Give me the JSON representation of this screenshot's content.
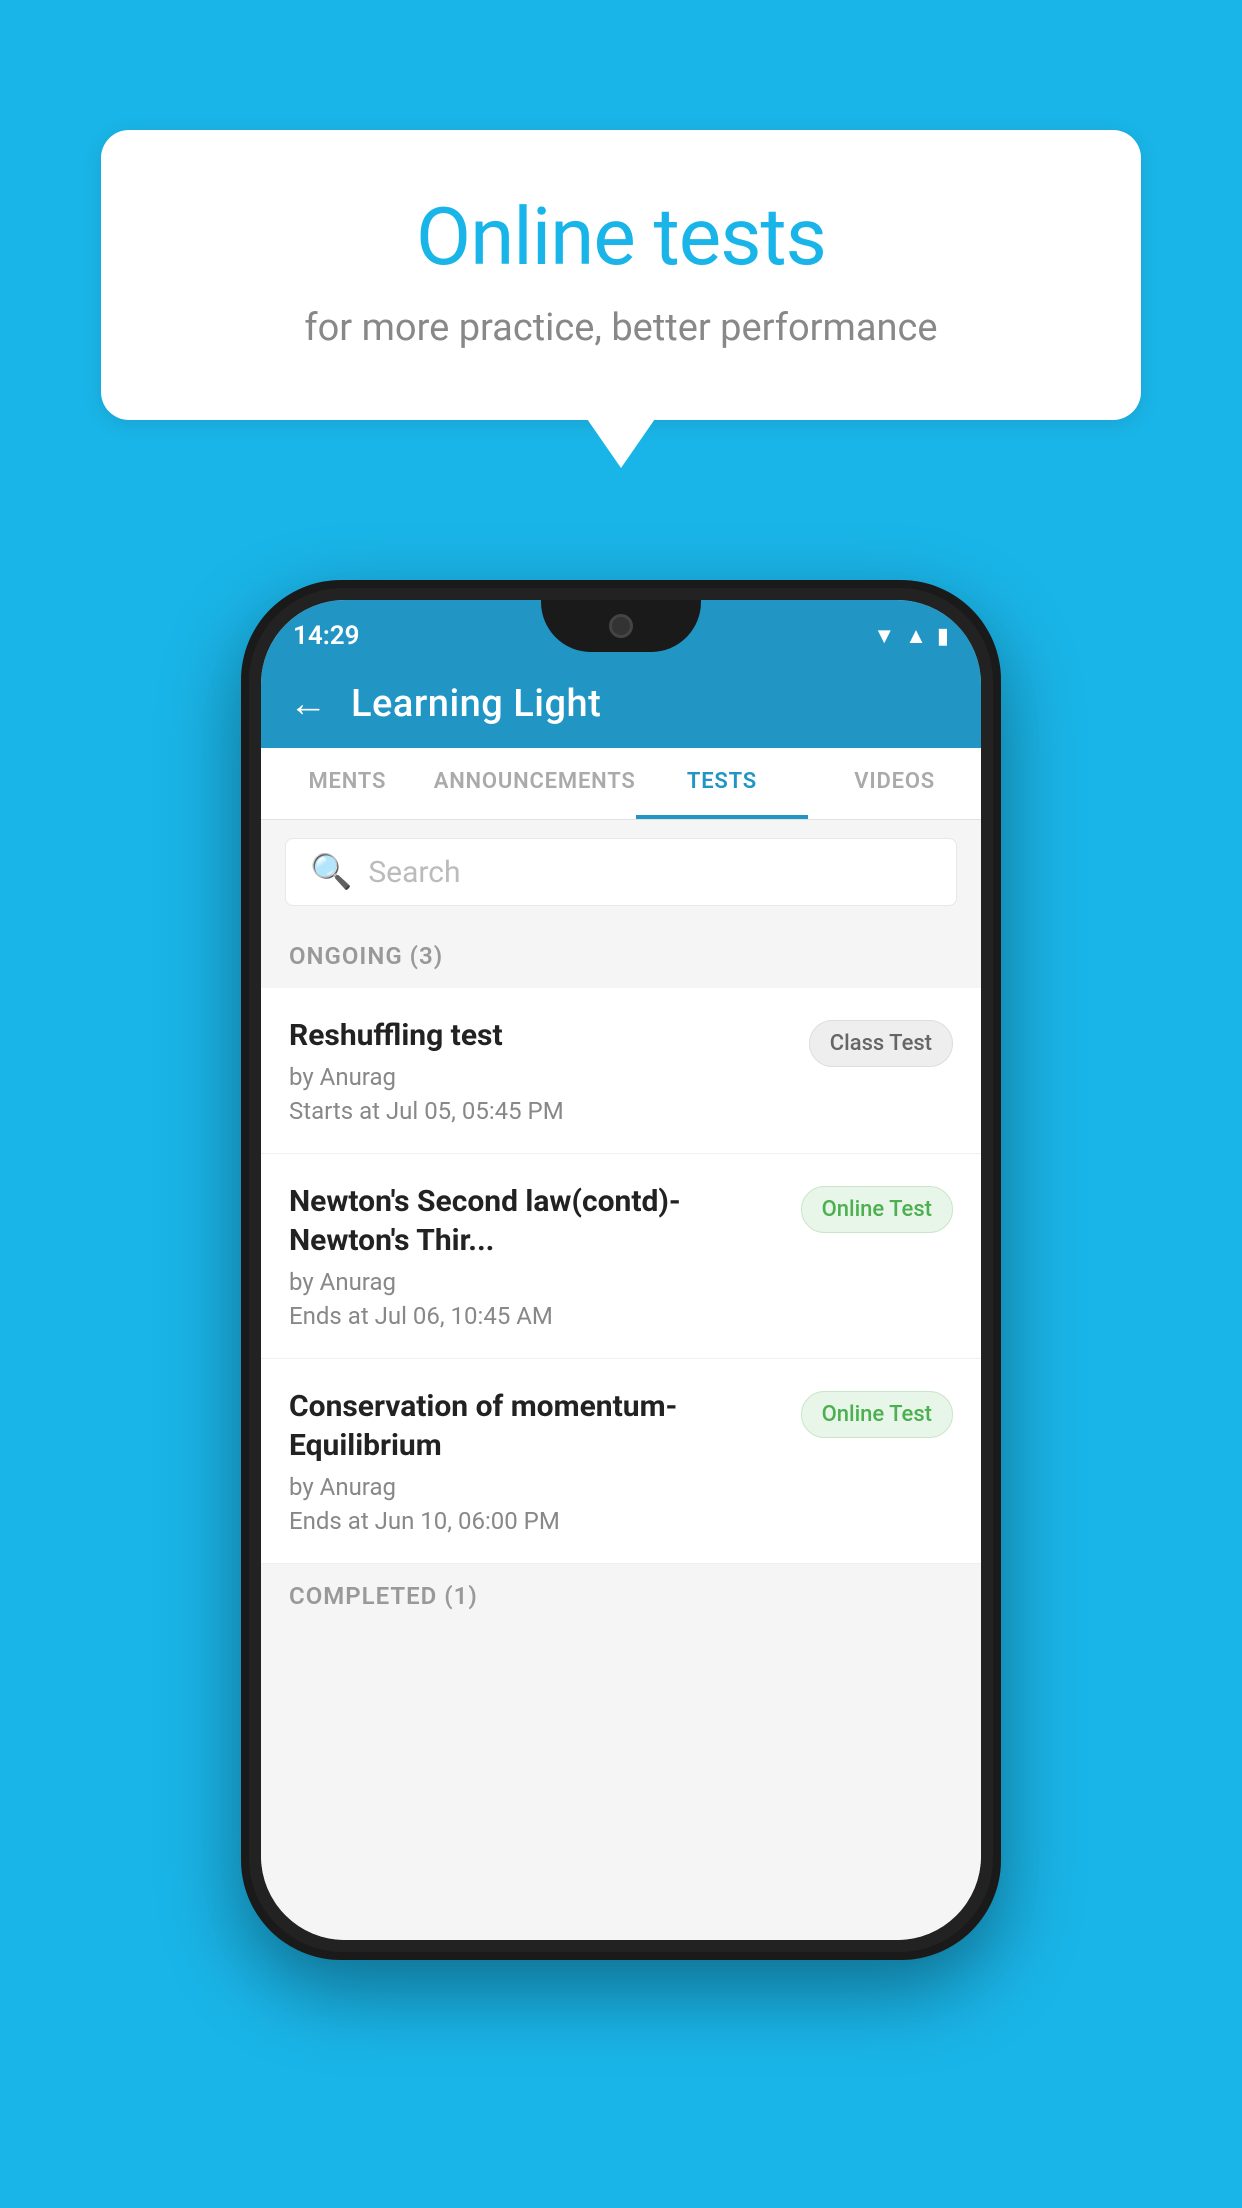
{
  "hero": {
    "title": "Online tests",
    "subtitle": "for more practice, better performance"
  },
  "app": {
    "title": "Learning Light",
    "status_time": "14:29"
  },
  "tabs": [
    {
      "id": "ments",
      "label": "MENTS",
      "active": false
    },
    {
      "id": "announcements",
      "label": "ANNOUNCEMENTS",
      "active": false
    },
    {
      "id": "tests",
      "label": "TESTS",
      "active": true
    },
    {
      "id": "videos",
      "label": "VIDEOS",
      "active": false
    }
  ],
  "search": {
    "placeholder": "Search"
  },
  "sections": {
    "ongoing": {
      "label": "ONGOING (3)",
      "tests": [
        {
          "name": "Reshuffling test",
          "author": "by Anurag",
          "date": "Starts at  Jul 05, 05:45 PM",
          "badge": "Class Test",
          "badge_type": "class"
        },
        {
          "name": "Newton's Second law(contd)-Newton's Thir...",
          "author": "by Anurag",
          "date": "Ends at  Jul 06, 10:45 AM",
          "badge": "Online Test",
          "badge_type": "online"
        },
        {
          "name": "Conservation of momentum-Equilibrium",
          "author": "by Anurag",
          "date": "Ends at  Jun 10, 06:00 PM",
          "badge": "Online Test",
          "badge_type": "online"
        }
      ]
    },
    "completed": {
      "label": "COMPLETED (1)"
    }
  }
}
